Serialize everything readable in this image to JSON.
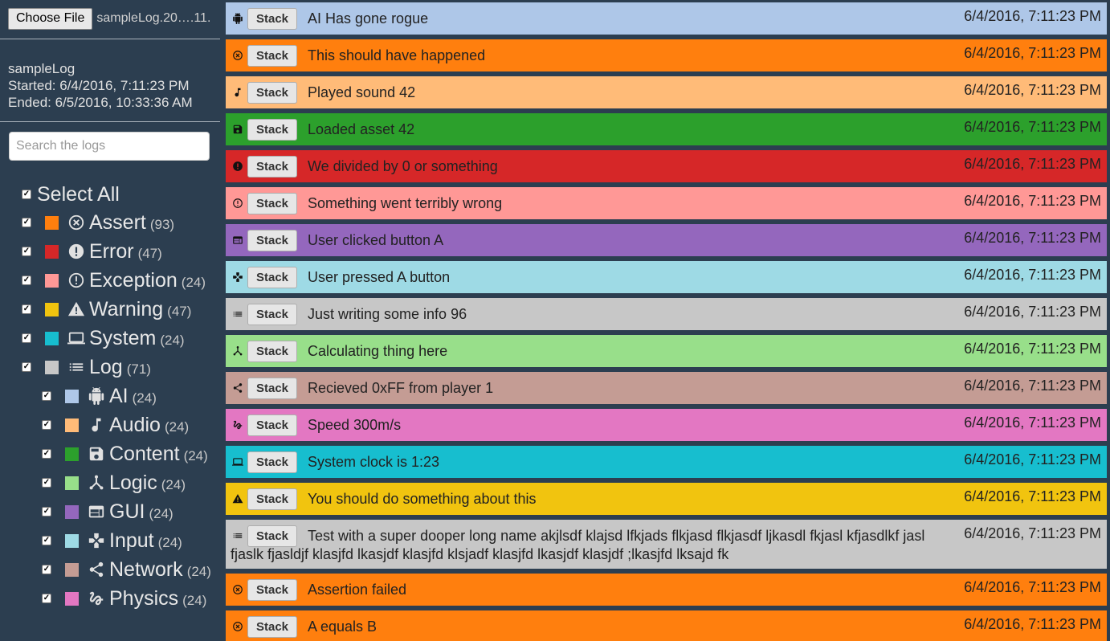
{
  "sidebar": {
    "choose_file_label": "Choose File",
    "file_name": "sampleLog.20….11.",
    "log_name": "sampleLog",
    "started": "Started: 6/4/2016, 7:11:23 PM",
    "ended": "Ended: 6/5/2016, 10:33:36 AM",
    "search_placeholder": "Search the logs",
    "select_all_label": "Select All",
    "filters": [
      {
        "label": "Assert",
        "count": "(93)",
        "color": "#ff7f0e",
        "icon": "cancel-circle-icon",
        "checked": true,
        "indent": false
      },
      {
        "label": "Error",
        "count": "(47)",
        "color": "#d62728",
        "icon": "error-icon",
        "checked": true,
        "indent": false
      },
      {
        "label": "Exception",
        "count": "(24)",
        "color": "#ff9896",
        "icon": "error-outline-icon",
        "checked": true,
        "indent": false
      },
      {
        "label": "Warning",
        "count": "(47)",
        "color": "#f1c40f",
        "icon": "warning-icon",
        "checked": true,
        "indent": false
      },
      {
        "label": "System",
        "count": "(24)",
        "color": "#17becf",
        "icon": "laptop-icon",
        "checked": true,
        "indent": false
      },
      {
        "label": "Log",
        "count": "(71)",
        "color": "#c7c7c7",
        "icon": "list-icon",
        "checked": true,
        "indent": false
      },
      {
        "label": "AI",
        "count": "(24)",
        "color": "#aec7e8",
        "icon": "android-icon",
        "checked": true,
        "indent": true
      },
      {
        "label": "Audio",
        "count": "(24)",
        "color": "#ffbb78",
        "icon": "music-note-icon",
        "checked": true,
        "indent": true
      },
      {
        "label": "Content",
        "count": "(24)",
        "color": "#2ca02c",
        "icon": "save-icon",
        "checked": true,
        "indent": true
      },
      {
        "label": "Logic",
        "count": "(24)",
        "color": "#98df8a",
        "icon": "call-split-icon",
        "checked": true,
        "indent": true
      },
      {
        "label": "GUI",
        "count": "(24)",
        "color": "#9467bd",
        "icon": "web-icon",
        "checked": true,
        "indent": true
      },
      {
        "label": "Input",
        "count": "(24)",
        "color": "#9edae5",
        "icon": "gamepad-icon",
        "checked": true,
        "indent": true
      },
      {
        "label": "Network",
        "count": "(24)",
        "color": "#c49c94",
        "icon": "share-icon",
        "checked": true,
        "indent": true
      },
      {
        "label": "Physics",
        "count": "(24)",
        "color": "#e377c2",
        "icon": "gesture-icon",
        "checked": true,
        "indent": true
      }
    ]
  },
  "stack_label": "Stack",
  "logs": [
    {
      "message": "AI Has gone rogue",
      "time": "6/4/2016, 7:11:23 PM",
      "color": "#aec7e8",
      "icon": "android-icon"
    },
    {
      "message": "This should have happened",
      "time": "6/4/2016, 7:11:23 PM",
      "color": "#ff7f0e",
      "icon": "cancel-circle-icon"
    },
    {
      "message": "Played sound 42",
      "time": "6/4/2016, 7:11:23 PM",
      "color": "#ffbb78",
      "icon": "music-note-icon"
    },
    {
      "message": "Loaded asset 42",
      "time": "6/4/2016, 7:11:23 PM",
      "color": "#2ca02c",
      "icon": "save-icon"
    },
    {
      "message": "We divided by 0 or something",
      "time": "6/4/2016, 7:11:23 PM",
      "color": "#d62728",
      "icon": "error-icon"
    },
    {
      "message": "Something went terribly wrong",
      "time": "6/4/2016, 7:11:23 PM",
      "color": "#ff9896",
      "icon": "error-outline-icon"
    },
    {
      "message": "User clicked button A",
      "time": "6/4/2016, 7:11:23 PM",
      "color": "#9467bd",
      "icon": "web-icon"
    },
    {
      "message": "User pressed A button",
      "time": "6/4/2016, 7:11:23 PM",
      "color": "#9edae5",
      "icon": "gamepad-icon"
    },
    {
      "message": "Just writing some info 96",
      "time": "6/4/2016, 7:11:23 PM",
      "color": "#c7c7c7",
      "icon": "list-icon"
    },
    {
      "message": "Calculating thing here",
      "time": "6/4/2016, 7:11:23 PM",
      "color": "#98df8a",
      "icon": "call-split-icon"
    },
    {
      "message": "Recieved 0xFF from player 1",
      "time": "6/4/2016, 7:11:23 PM",
      "color": "#c49c94",
      "icon": "share-icon"
    },
    {
      "message": "Speed 300m/s",
      "time": "6/4/2016, 7:11:23 PM",
      "color": "#e377c2",
      "icon": "gesture-icon"
    },
    {
      "message": "System clock is 1:23",
      "time": "6/4/2016, 7:11:23 PM",
      "color": "#17becf",
      "icon": "laptop-icon"
    },
    {
      "message": "You should do something about this",
      "time": "6/4/2016, 7:11:23 PM",
      "color": "#f1c40f",
      "icon": "warning-icon"
    },
    {
      "message": "Test with a super dooper long name akjlsdf klajsd lfkjads flkjasd flkjasdf ljkasdl fkjasl kfjasdlkf jasl fjaslk fjasldjf klasjfd lkasjdf klasjfd klsjadf klasjfd lkasjdf klasjdf ;lkasjfd lksajd fk",
      "time": "6/4/2016, 7:11:23 PM",
      "color": "#c7c7c7",
      "icon": "list-icon"
    },
    {
      "message": "Assertion failed",
      "time": "6/4/2016, 7:11:23 PM",
      "color": "#ff7f0e",
      "icon": "cancel-circle-icon"
    },
    {
      "message": "A equals B",
      "time": "6/4/2016, 7:11:23 PM",
      "color": "#ff7f0e",
      "icon": "cancel-circle-icon"
    }
  ]
}
